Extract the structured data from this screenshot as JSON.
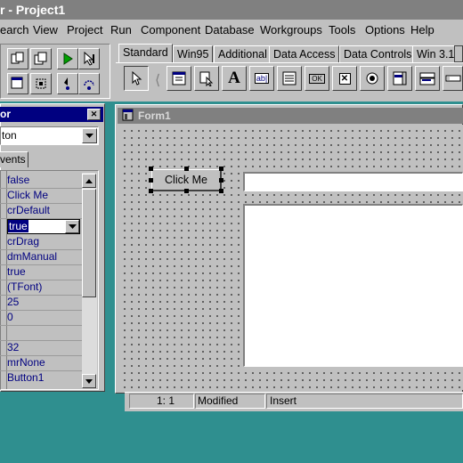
{
  "app": {
    "title": "r - Project1"
  },
  "menu": {
    "items": [
      "earch",
      "View",
      "Project",
      "Run",
      "Component",
      "Database",
      "Workgroups",
      "Tools",
      "Options",
      "Help"
    ]
  },
  "palette": {
    "tabs": [
      "Standard",
      "Win95",
      "Additional",
      "Data Access",
      "Data Controls",
      "Win 3.1"
    ],
    "components": [
      "pointer-arrow",
      "main-menu",
      "popup-menu",
      "label",
      "edit",
      "memo",
      "button",
      "checkbox",
      "radiobutton",
      "listbox",
      "combobox",
      "scrollbar"
    ]
  },
  "inspector": {
    "title": "or",
    "close_glyph": "✕",
    "object_selector": "ton",
    "tab_events": "vents",
    "values": [
      "false",
      "Click Me",
      "crDefault",
      "true",
      "crDrag",
      "dmManual",
      "true",
      "(TFont)",
      "25",
      "0",
      "",
      "32",
      "mrNone",
      "Button1"
    ],
    "selected_index": 3
  },
  "form": {
    "title": "Form1",
    "button_label": "Click Me"
  },
  "statusbar": {
    "position": "1:   1",
    "modified": "Modified",
    "mode": "Insert"
  },
  "colors": {
    "desktop": "#2f8f8f",
    "titlebar": "#000080",
    "face": "#c0c0c0"
  }
}
